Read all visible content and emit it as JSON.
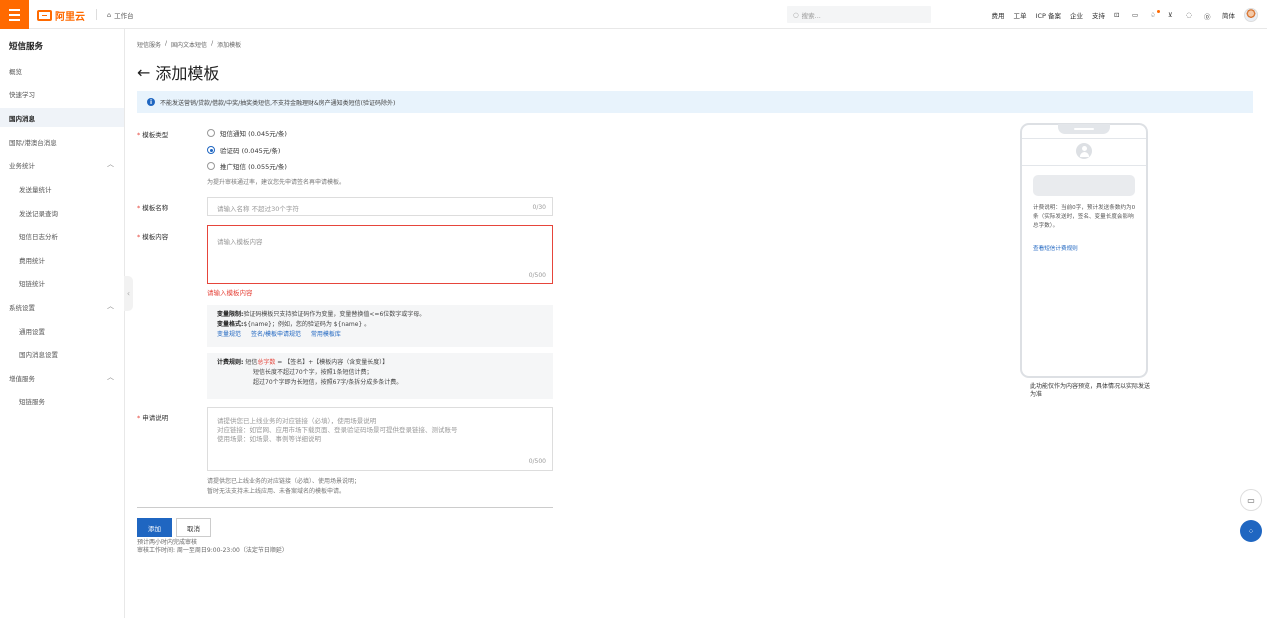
{
  "header": {
    "brand": "阿里云",
    "workbench": "工作台",
    "search_placeholder": "搜索...",
    "nav": [
      "费用",
      "工单",
      "ICP 备案",
      "企业",
      "支持"
    ],
    "lang": "简体"
  },
  "sidebar": {
    "title": "短信服务",
    "items": {
      "overview": "概览",
      "quickstart": "快速学习",
      "domestic": "国内消息",
      "intl": "国际/港澳台消息",
      "stats": "业务统计",
      "send_stats": "发送量统计",
      "send_records": "发送记录查询",
      "log_analysis": "短信日志分析",
      "cost_stats": "费用统计",
      "shortlink_stats": "短链统计",
      "settings": "系统设置",
      "general": "通用设置",
      "domestic_settings": "国内消息设置",
      "value_added": "增值服务",
      "shortlink": "短链服务"
    }
  },
  "breadcrumb": [
    "短信服务",
    "国内文本短信",
    "添加模板"
  ],
  "page_title": "添加模板",
  "alert": "不能发送营销/贷款/借款/中奖/抽奖类短信,不支持金融理财&房产通知类短信(验证码除外)",
  "form": {
    "type_label": "模板类型",
    "types": [
      "短信通知 (0.045元/条)",
      "验证码 (0.045元/条)",
      "推广短信 (0.055元/条)"
    ],
    "selected_type": "验证码 (0.045元/条)",
    "type_hint": "为提升审核通过率，建议您先申请签名再申请模板。",
    "name_label": "模板名称",
    "name_placeholder": "请输入名称 不超过30个字符",
    "name_counter": "0/30",
    "content_label": "模板内容",
    "content_placeholder": "请输入模板内容",
    "content_counter": "0/500",
    "content_error": "请输入模板内容",
    "var_rule_title": "变量限制:",
    "var_rule_text": "验证码模板只支持验证码作为变量，变量替换值<=6位数字或字母。",
    "var_format_title": "变量格式:",
    "var_format_text": "${name}；例如，您的验证码为 ${name} 。",
    "links": [
      "变量规范",
      "签名/模板申请规范",
      "常用模板库"
    ],
    "billing_title": "计费规则:",
    "billing_line1_a": "短信",
    "billing_line1_hl": "总字数",
    "billing_line1_b": " = 【签名】+【模板内容（含变量长度）】",
    "billing_line2": "短信长度不超过70个字，按照1条短信计费；",
    "billing_line3": "超过70个字即为长短信，按照67字/条拆分成多条计费。",
    "desc_label": "申请说明",
    "desc_placeholder_1": "请提供您已上线业务的对应链接（必填），使用场景说明",
    "desc_placeholder_2": "对应链接：如官网、应用市场下载页面、登录验证码场景可提供登录链接、测试账号",
    "desc_placeholder_3": "使用场景：如场景、事例等详细说明",
    "desc_counter": "0/500",
    "desc_hint_1": "请提供您已上线业务的对应链接（必填）、使用场景说明；",
    "desc_hint_2": "暂时无法支持未上线应用、未备案域名的模板申请。",
    "submit": "添加",
    "cancel": "取消",
    "foot_1": "预计两小时内完成审核",
    "foot_2": "审核工作时间: 周一至周日9:00-23:00（法定节日顺延）"
  },
  "preview": {
    "note": "计费说明：当前0字，预计发送条数约为0条（实际发送时，签名、变量长度会影响总字数）。",
    "link": "查看短信计费规则",
    "disclaimer": "此功能仅作为内容预览，具体情况以实际发送为准"
  },
  "colors": {
    "brand": "#ff6a00",
    "primary": "#1f66c1",
    "error": "#e6453b"
  }
}
